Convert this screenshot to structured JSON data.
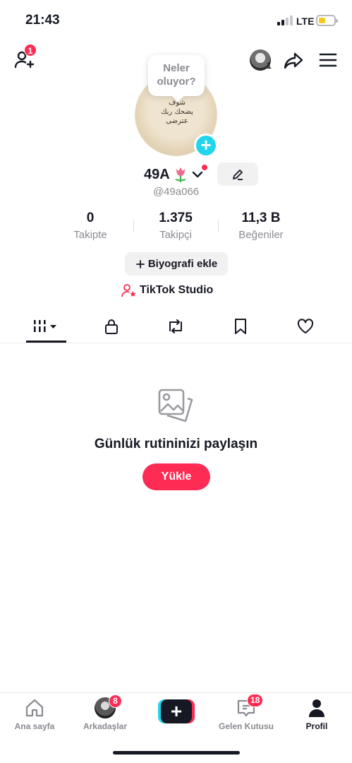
{
  "status_bar": {
    "time": "21:43",
    "network": "LTE",
    "battery_color": "#f7c91e"
  },
  "top_bar": {
    "add_friend_badge": "1",
    "account_switch_count": "1"
  },
  "avatar": {
    "bubble_text": "Neler oluyor?",
    "image_text": "شوف يضحك ربك عترضى",
    "add_icon": "plus-icon"
  },
  "profile": {
    "name": "49A",
    "handle": "@49a066",
    "name_emoji": "tulip-icon"
  },
  "stats": [
    {
      "value": "0",
      "label": "Takipte"
    },
    {
      "value": "1.375",
      "label": "Takipçi"
    },
    {
      "value": "11,3 B",
      "label": "Beğeniler"
    }
  ],
  "actions": {
    "bio": "Biyografi ekle",
    "studio": "TikTok Studio"
  },
  "tabs": [
    "grid-icon",
    "lock-icon",
    "repost-icon",
    "bookmark-icon",
    "heart-icon"
  ],
  "empty": {
    "title": "Günlük rutininizi paylaşın",
    "upload": "Yükle"
  },
  "bottom_nav": {
    "home": "Ana sayfa",
    "friends": "Arkadaşlar",
    "friends_badge": "8",
    "inbox": "Gelen Kutusu",
    "inbox_badge": "18",
    "profile": "Profil"
  },
  "colors": {
    "accent": "#fe2c55",
    "cyan": "#20d5ec",
    "text": "#161823",
    "muted": "#8a8b91"
  }
}
